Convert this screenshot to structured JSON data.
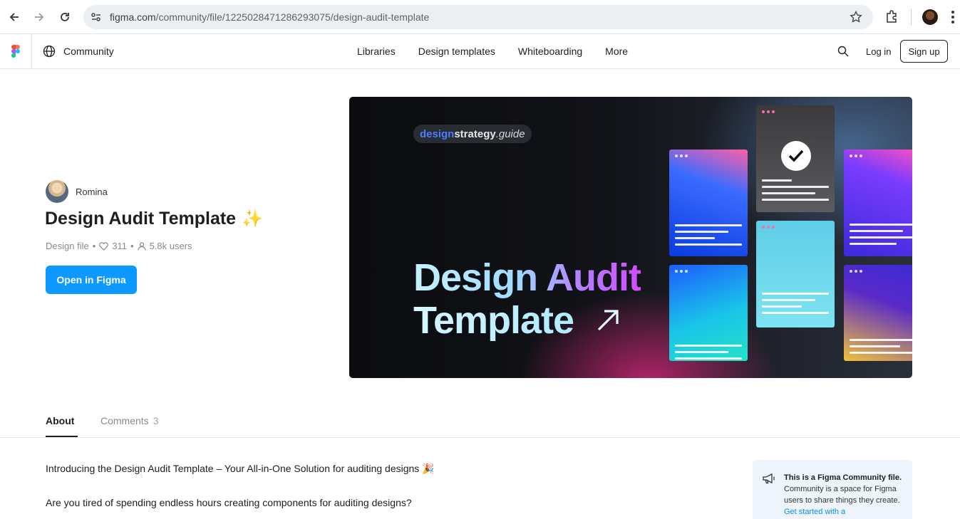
{
  "browser": {
    "url_host": "figma.com",
    "url_path": "/community/file/1225028471286293075/design-audit-template"
  },
  "header": {
    "section": "Community",
    "nav": [
      "Libraries",
      "Design templates",
      "Whiteboarding",
      "More"
    ],
    "login": "Log in",
    "signup": "Sign up"
  },
  "file": {
    "author": "Romina",
    "title": "Design Audit Template",
    "title_emoji": "✨",
    "type": "Design file",
    "likes": "311",
    "users": "5.8k users",
    "open_button": "Open in Figma"
  },
  "hero": {
    "brand_part1": "design",
    "brand_part2": "strategy",
    "brand_part3": ".guide",
    "title_line1": "Design Audit",
    "title_line2": "Template"
  },
  "tabs": {
    "about": "About",
    "comments": "Comments",
    "comments_count": "3"
  },
  "description": {
    "line1": "Introducing the Design Audit Template – Your All-in-One Solution for auditing designs 🎉",
    "line2": "Are you tired of spending endless hours creating components for auditing designs?"
  },
  "notice": {
    "bold": "This is a Figma Community file.",
    "body": " Community is a space for Figma users to share things they create. ",
    "link": "Get started with a"
  },
  "colors": {
    "accent_blue": "#0d99ff",
    "link_blue": "#0c8ce9"
  }
}
